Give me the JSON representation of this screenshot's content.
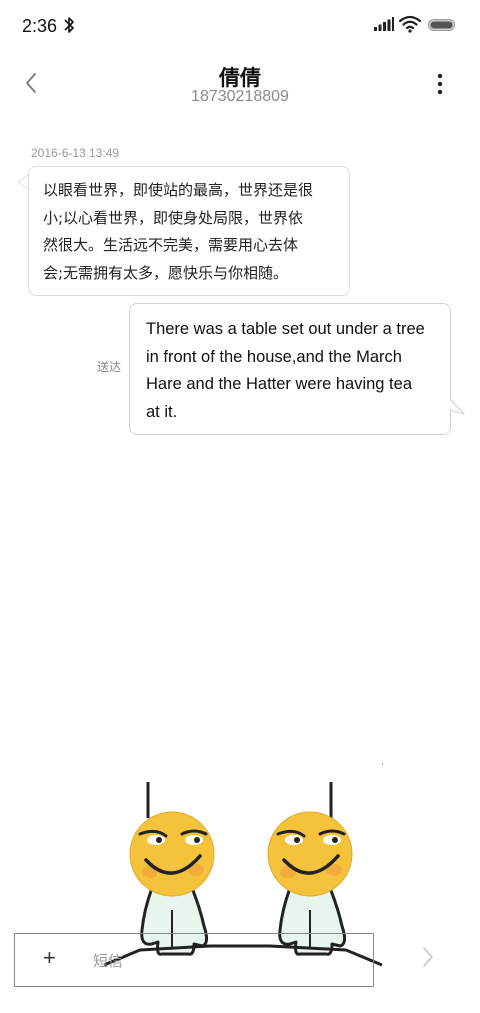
{
  "status_bar": {
    "time": "2:36",
    "icons": [
      "bluetooth-icon",
      "signal-icon",
      "wifi-icon",
      "battery-icon"
    ]
  },
  "header": {
    "contact_name": "倩倩",
    "contact_number": "18730218809",
    "back_icon": "chevron-left-icon",
    "more_icon": "more-vertical-icon"
  },
  "messages": [
    {
      "direction": "incoming",
      "timestamp": "2016-6-13 13:49",
      "lines": [
        "以眼看世界，即使站的最高，世界还是很",
        "小;以心看世界，即使身处局限，世界依",
        "然很大。生活远不完美，需要用心去体",
        "会;无需拥有太多，愿快乐与你相随。"
      ]
    },
    {
      "direction": "outgoing",
      "status": "送达",
      "lines": [
        "There was a table set out under a tree",
        "in front of the house,and the March",
        "Hare and the Hatter were having tea",
        "at it."
      ]
    }
  ],
  "composer": {
    "attach_label": "+",
    "placeholder": "短信",
    "send_icon": "chevron-right-icon"
  },
  "colors": {
    "background": "#ffffff",
    "bubble_border": "#d0d0d0",
    "secondary_text": "#8a8a8a",
    "sticker_face": "#f5c33b"
  }
}
